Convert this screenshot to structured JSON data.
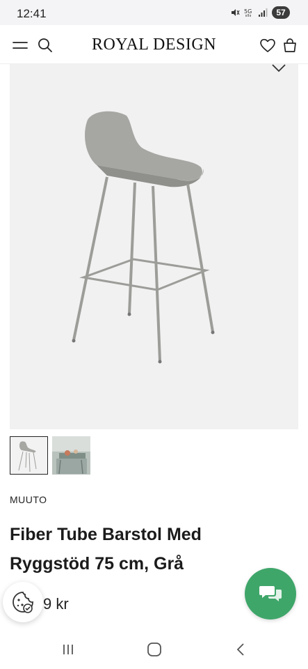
{
  "status_bar": {
    "time": "12:41",
    "battery": "57",
    "icons": [
      "mute-icon",
      "5g-icon",
      "signal-icon",
      "battery-icon"
    ]
  },
  "header": {
    "brand": "ROYAL DESIGN",
    "icons": [
      "menu-icon",
      "search-icon",
      "heart-icon",
      "bag-icon"
    ]
  },
  "product": {
    "brand": "MUUTO",
    "title": "Fiber Tube Barstol Med Ryggstöd 75 cm, Grå",
    "price_visible": "9 kr",
    "thumbnails": [
      {
        "name": "barstool-gray",
        "active": true
      },
      {
        "name": "lifestyle-kitchen",
        "active": false
      }
    ]
  },
  "colors": {
    "chat_button": "#3fa66a",
    "image_bg": "#f1f1f1",
    "chair_gray": "#a9aaa6"
  },
  "floating": {
    "cookie_icon": "cookie-icon",
    "chat_icon": "chat-icon"
  },
  "navbar": {
    "icons": [
      "recent-apps-icon",
      "home-icon",
      "back-icon"
    ]
  }
}
